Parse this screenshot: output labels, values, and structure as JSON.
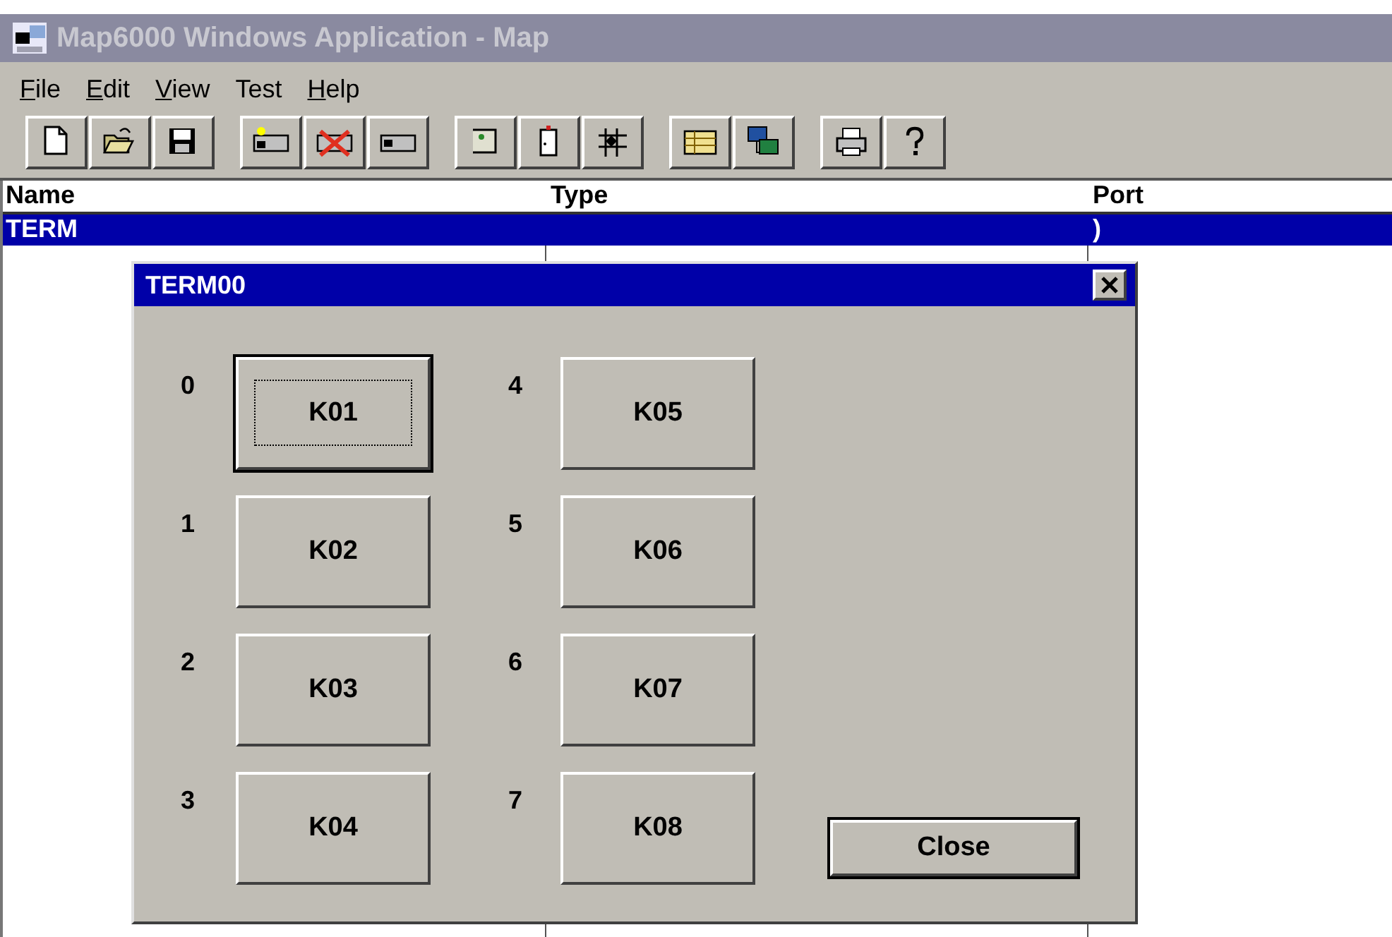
{
  "window": {
    "title": "Map6000 Windows Application - Map",
    "active": false
  },
  "menu": [
    {
      "label": "File",
      "underline_first": true
    },
    {
      "label": "Edit",
      "underline_first": true
    },
    {
      "label": "View",
      "underline_first": true
    },
    {
      "label": "Test",
      "underline_first": false
    },
    {
      "label": "Help",
      "underline_first": true
    }
  ],
  "toolbar": [
    [
      {
        "kind": "new"
      },
      {
        "kind": "open"
      },
      {
        "kind": "save"
      }
    ],
    [
      {
        "kind": "add-terminal"
      },
      {
        "kind": "delete-terminal"
      },
      {
        "kind": "terminal"
      }
    ],
    [
      {
        "kind": "panel"
      },
      {
        "kind": "door"
      },
      {
        "kind": "grid"
      }
    ],
    [
      {
        "kind": "table"
      },
      {
        "kind": "network"
      }
    ],
    [
      {
        "kind": "print"
      },
      {
        "kind": "help"
      }
    ]
  ],
  "list": {
    "columns": [
      "Name",
      "Type",
      "Port"
    ],
    "rows": [
      {
        "name": "TERM",
        "port": ")",
        "selected": true
      }
    ]
  },
  "dialog": {
    "title": "TERM00",
    "keys": [
      {
        "number": "0",
        "label": "K01",
        "focused": true
      },
      {
        "number": "1",
        "label": "K02",
        "focused": false
      },
      {
        "number": "2",
        "label": "K03",
        "focused": false
      },
      {
        "number": "3",
        "label": "K04",
        "focused": false
      },
      {
        "number": "4",
        "label": "K05",
        "focused": false
      },
      {
        "number": "5",
        "label": "K06",
        "focused": false
      },
      {
        "number": "6",
        "label": "K07",
        "focused": false
      },
      {
        "number": "7",
        "label": "K08",
        "focused": false
      }
    ],
    "close_button": {
      "label": "Close",
      "default": true
    }
  }
}
